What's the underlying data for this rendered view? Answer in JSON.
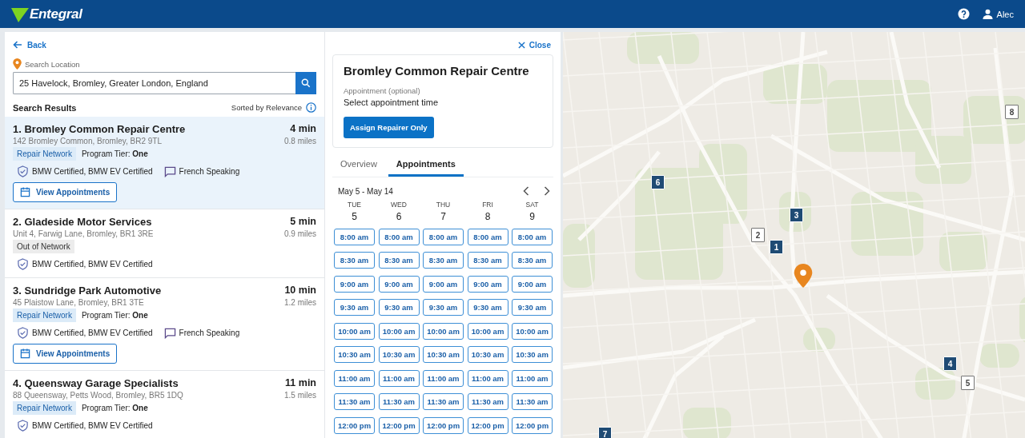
{
  "header": {
    "logo": "Entegral",
    "user": "Alec"
  },
  "search": {
    "back": "Back",
    "label": "Search Location",
    "value": "25 Havelock, Bromley, Greater London, England"
  },
  "results": {
    "title": "Search Results",
    "sort": "Sorted by Relevance",
    "items": [
      {
        "name": "1. Bromley Common Repair Centre",
        "address": "142 Bromley Common, Bromley, BR2 9TL",
        "time": "4 min",
        "distance": "0.8 miles",
        "network": {
          "kind": "in",
          "label": "Repair Network"
        },
        "tier": "Program Tier: **One**",
        "certs": "BMW Certified, BMW EV Certified",
        "language": "French Speaking",
        "button": "View Appointments",
        "selected": true
      },
      {
        "name": "2. Gladeside Motor Services",
        "address": "Unit 4, Farwig Lane, Bromley, BR1 3RE",
        "time": "5 min",
        "distance": "0.9 miles",
        "network": {
          "kind": "out",
          "label": "Out of Network"
        },
        "certs": "BMW Certified, BMW EV Certified",
        "selected": false
      },
      {
        "name": "3. Sundridge Park Automotive",
        "address": "45 Plaistow Lane, Bromley, BR1 3TE",
        "time": "10 min",
        "distance": "1.2 miles",
        "network": {
          "kind": "in",
          "label": "Repair Network"
        },
        "tier": "Program Tier: **One**",
        "certs": "BMW Certified, BMW EV Certified",
        "language": "French Speaking",
        "button": "View Appointments",
        "selected": false
      },
      {
        "name": "4. Queensway Garage Specialists",
        "address": "88 Queensway, Petts Wood, Bromley, BR5 1DQ",
        "time": "11 min",
        "distance": "1.5 miles",
        "network": {
          "kind": "in",
          "label": "Repair Network"
        },
        "tier": "Program Tier: **One**",
        "certs": "BMW Certified, BMW EV Certified",
        "selected": false
      }
    ]
  },
  "detail": {
    "close": "Close",
    "title": "Bromley Common Repair Centre",
    "appointment_label": "Appointment (optional)",
    "appointment_value": "Select appointment time",
    "assign_button": "Assign Repairer Only",
    "tabs": [
      {
        "label": "Overview",
        "selected": false
      },
      {
        "label": "Appointments",
        "selected": true
      }
    ],
    "range": "May 5 - May 14",
    "days": [
      {
        "weekday": "TUE",
        "date": "5",
        "slots": [
          "8:00 am",
          "8:30 am",
          "9:00 am",
          "9:30 am",
          "10:00 am",
          "10:30 am",
          "11:00 am",
          "11:30 am",
          "12:00 pm"
        ]
      },
      {
        "weekday": "WED",
        "date": "6",
        "slots": [
          "8:00 am",
          "8:30 am",
          "9:00 am",
          "9:30 am",
          "10:00 am",
          "10:30 am",
          "11:00 am",
          "11:30 am",
          "12:00 pm"
        ]
      },
      {
        "weekday": "THU",
        "date": "7",
        "slots": [
          "8:00 am",
          "8:30 am",
          "9:00 am",
          "9:30 am",
          "10:00 am",
          "10:30 am",
          "11:00 am",
          "11:30 am",
          "12:00 pm"
        ]
      },
      {
        "weekday": "FRI",
        "date": "8",
        "slots": [
          "8:00 am",
          "8:30 am",
          "9:00 am",
          "9:30 am",
          "10:00 am",
          "10:30 am",
          "11:00 am",
          "11:30 am",
          "12:00 pm"
        ]
      },
      {
        "weekday": "SAT",
        "date": "9",
        "slots": [
          "8:00 am",
          "8:30 am",
          "9:00 am",
          "9:30 am",
          "10:00 am",
          "10:30 am",
          "11:00 am",
          "11:30 am",
          "12:00 pm"
        ]
      }
    ]
  },
  "map": {
    "markers": [
      {
        "label": "1",
        "kind": "in"
      },
      {
        "label": "2",
        "kind": "out"
      },
      {
        "label": "3",
        "kind": "in"
      },
      {
        "label": "4",
        "kind": "in"
      },
      {
        "label": "5",
        "kind": "out"
      },
      {
        "label": "6",
        "kind": "in"
      },
      {
        "label": "7",
        "kind": "in"
      },
      {
        "label": "8",
        "kind": "out"
      }
    ]
  }
}
